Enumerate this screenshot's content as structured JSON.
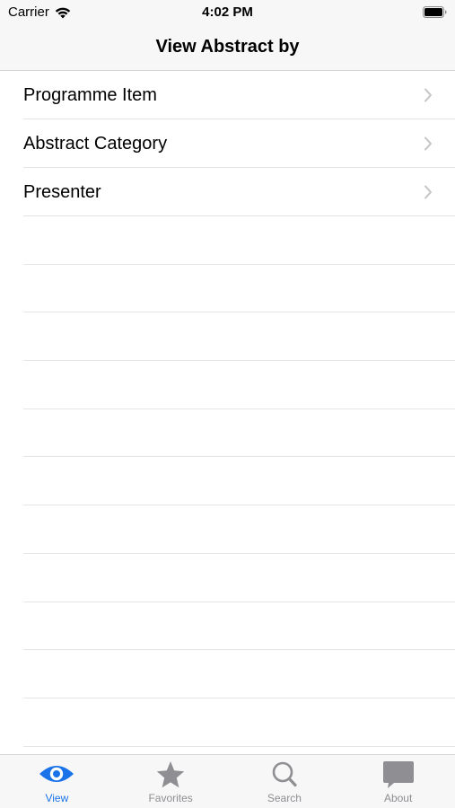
{
  "status_bar": {
    "carrier": "Carrier",
    "time": "4:02 PM",
    "wifi_icon": "wifi-icon",
    "battery_icon": "battery-icon"
  },
  "nav": {
    "title": "View Abstract by"
  },
  "list": {
    "items": [
      {
        "label": "Programme Item",
        "icon": "chevron-right-icon"
      },
      {
        "label": "Abstract Category",
        "icon": "chevron-right-icon"
      },
      {
        "label": "Presenter",
        "icon": "chevron-right-icon"
      }
    ]
  },
  "tabs": [
    {
      "label": "View",
      "icon": "eye-icon",
      "active": true
    },
    {
      "label": "Favorites",
      "icon": "star-icon",
      "active": false
    },
    {
      "label": "Search",
      "icon": "search-icon",
      "active": false
    },
    {
      "label": "About",
      "icon": "speech-bubble-icon",
      "active": false
    }
  ],
  "colors": {
    "accent": "#1a73e8",
    "inactive": "#8e8e93",
    "bar_background": "#f7f7f7"
  }
}
